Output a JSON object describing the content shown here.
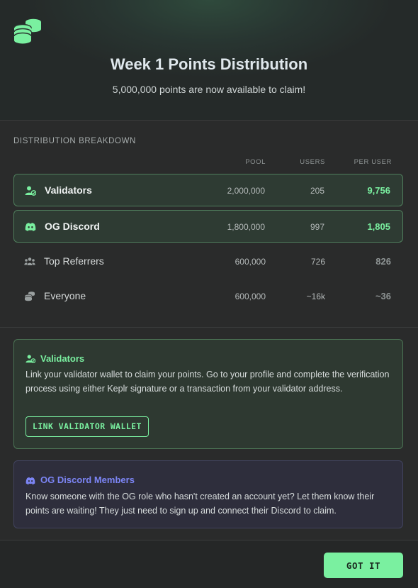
{
  "header": {
    "icon": "coins-stack-icon",
    "title": "Week 1 Points Distribution",
    "subtitle": "5,000,000 points are now available to claim!"
  },
  "breakdown": {
    "label": "DISTRIBUTION BREAKDOWN",
    "columns": {
      "pool": "POOL",
      "users": "USERS",
      "per_user": "PER USER"
    },
    "rows": [
      {
        "icon": "user-check-icon",
        "name": "Validators",
        "pool": "2,000,000",
        "users": "205",
        "per_user": "9,756",
        "highlighted": true
      },
      {
        "icon": "discord-icon",
        "name": "OG Discord",
        "pool": "1,800,000",
        "users": "997",
        "per_user": "1,805",
        "highlighted": true
      },
      {
        "icon": "users-group-icon",
        "name": "Top Referrers",
        "pool": "600,000",
        "users": "726",
        "per_user": "826",
        "highlighted": false
      },
      {
        "icon": "coins-icon",
        "name": "Everyone",
        "pool": "600,000",
        "users": "~16k",
        "per_user": "~36",
        "highlighted": false
      }
    ]
  },
  "validators_card": {
    "icon": "user-check-icon",
    "title": "Validators",
    "body": "Link your validator wallet to claim your points. Go to your profile and complete the verification process using either Keplr signature or a transaction from your validator address.",
    "button": "LINK VALIDATOR WALLET"
  },
  "og_card": {
    "icon": "discord-icon",
    "title": "OG Discord Members",
    "body": "Know someone with the OG role who hasn't created an account yet? Let them know their points are waiting! They just need to sign up and connect their Discord to claim."
  },
  "footer": {
    "button": "GOT IT"
  },
  "colors": {
    "accent": "#7af0a0",
    "discord": "#7c85f5",
    "background": "#2a2b2b"
  }
}
